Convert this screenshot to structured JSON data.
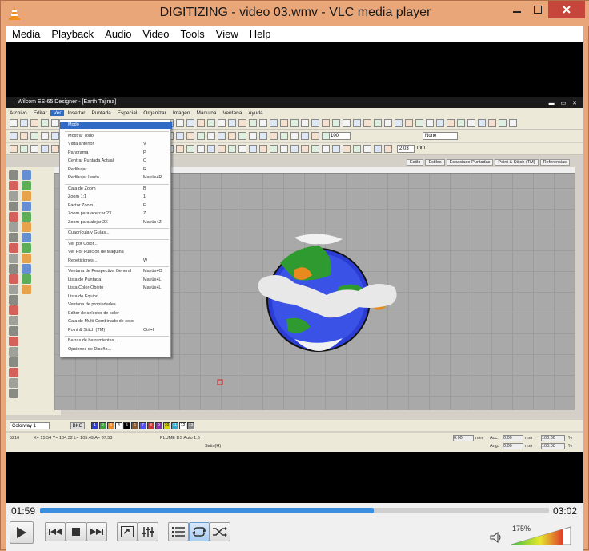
{
  "window": {
    "title": "DIGITIZING - video 03.wmv - VLC media player"
  },
  "menu": [
    "Media",
    "Playback",
    "Audio",
    "Video",
    "Tools",
    "View",
    "Help"
  ],
  "embedded_app": {
    "title": "Wilcom ES-65 Designer - [Earth     Tajima]",
    "menu": [
      "Archivo",
      "Editar",
      "Ver",
      "Insertar",
      "Puntada",
      "Especial",
      "Organizar",
      "Imagen",
      "Máquina",
      "Ventana",
      "Ayuda"
    ],
    "selected_menu": "Ver",
    "dropdown": [
      {
        "label": "Modo",
        "shortcut": ""
      },
      {
        "label": "Mostrar Todo",
        "shortcut": ""
      },
      {
        "label": "Vista anterior",
        "shortcut": "V"
      },
      {
        "label": "Panorama",
        "shortcut": "P"
      },
      {
        "label": "Centrar Puntada Actual",
        "shortcut": "C"
      },
      {
        "label": "Redibujar",
        "shortcut": "R"
      },
      {
        "label": "Redibujar Lento...",
        "shortcut": "Mayús+R"
      },
      {
        "label": "Caja de Zoom",
        "shortcut": "B"
      },
      {
        "label": "Zoom 1:1",
        "shortcut": "1"
      },
      {
        "label": "Factor Zoom...",
        "shortcut": "F"
      },
      {
        "label": "Zoom para acercar 2X",
        "shortcut": "Z"
      },
      {
        "label": "Zoom para alejar 2X",
        "shortcut": "Mayús+Z"
      },
      {
        "label": "Cuadrícula y Guías...",
        "shortcut": ""
      },
      {
        "label": "Ver por Color...",
        "shortcut": ""
      },
      {
        "label": "Ver Por Función de Máquina",
        "shortcut": ""
      },
      {
        "label": "Repeticiones...",
        "shortcut": "W"
      },
      {
        "label": "Ventana de Perspectiva General",
        "shortcut": "Mayús+O"
      },
      {
        "label": "Lista de Puntada",
        "shortcut": "Mayús+L"
      },
      {
        "label": "Lista Color-Objeto",
        "shortcut": "Mayús+L"
      },
      {
        "label": "Lista de Equipo",
        "shortcut": ""
      },
      {
        "label": "Ventana de propiedades",
        "shortcut": ""
      },
      {
        "label": "Editor de selector de color",
        "shortcut": ""
      },
      {
        "label": "Caja de Multi-Combinado de color",
        "shortcut": ""
      },
      {
        "label": "Point & Stitch (TM)",
        "shortcut": "Ctrl+I"
      },
      {
        "label": "Barras de herramientas...",
        "shortcut": ""
      },
      {
        "label": "Opciones de Diseño...",
        "shortcut": ""
      }
    ],
    "tabs": [
      "Estilo",
      "Estilos",
      "Espaciado-Puntadas",
      "Point & Stitch (TM)",
      "Referencias"
    ],
    "zoom_value": "100",
    "stitch_value": "2.03",
    "stitch_unit": "mm",
    "style_dropdown": "None",
    "palette_label": "Colorway 1",
    "bkg_label": "BKG",
    "palette_numbers": [
      "1",
      "2",
      "3",
      "4",
      "5",
      "6",
      "7",
      "8",
      "9",
      "10",
      "11",
      "12",
      "13"
    ],
    "palette_colors": [
      "#2b3dd4",
      "#3aa33a",
      "#e88a1e",
      "#ffffff",
      "#000000",
      "#8b5a2b",
      "#5050ff",
      "#cc3333",
      "#8833aa",
      "#d4d400",
      "#33aacc",
      "#ffffff",
      "#888888"
    ],
    "status": {
      "stitch_count": "5216",
      "coords": "X= 15.54  Y= 104.32  L= 105.49  A= 87.53",
      "machine": "PLUME DS Auto 1.6",
      "satin": "Satin(H)",
      "field1": "0.00",
      "unit1": "mm",
      "label_acc": "Acc.",
      "field2": "0.00",
      "unit2": "mm",
      "field3": "100.00",
      "pct": "%",
      "label_ang": "Ang.",
      "field4": "0.00",
      "unit3": "mm",
      "field5": "100.00",
      "pct2": "%"
    }
  },
  "player": {
    "time_current": "01:59",
    "time_total": "03:02",
    "progress": 0.655,
    "volume_label": "175%",
    "volume_level": 1.75
  }
}
